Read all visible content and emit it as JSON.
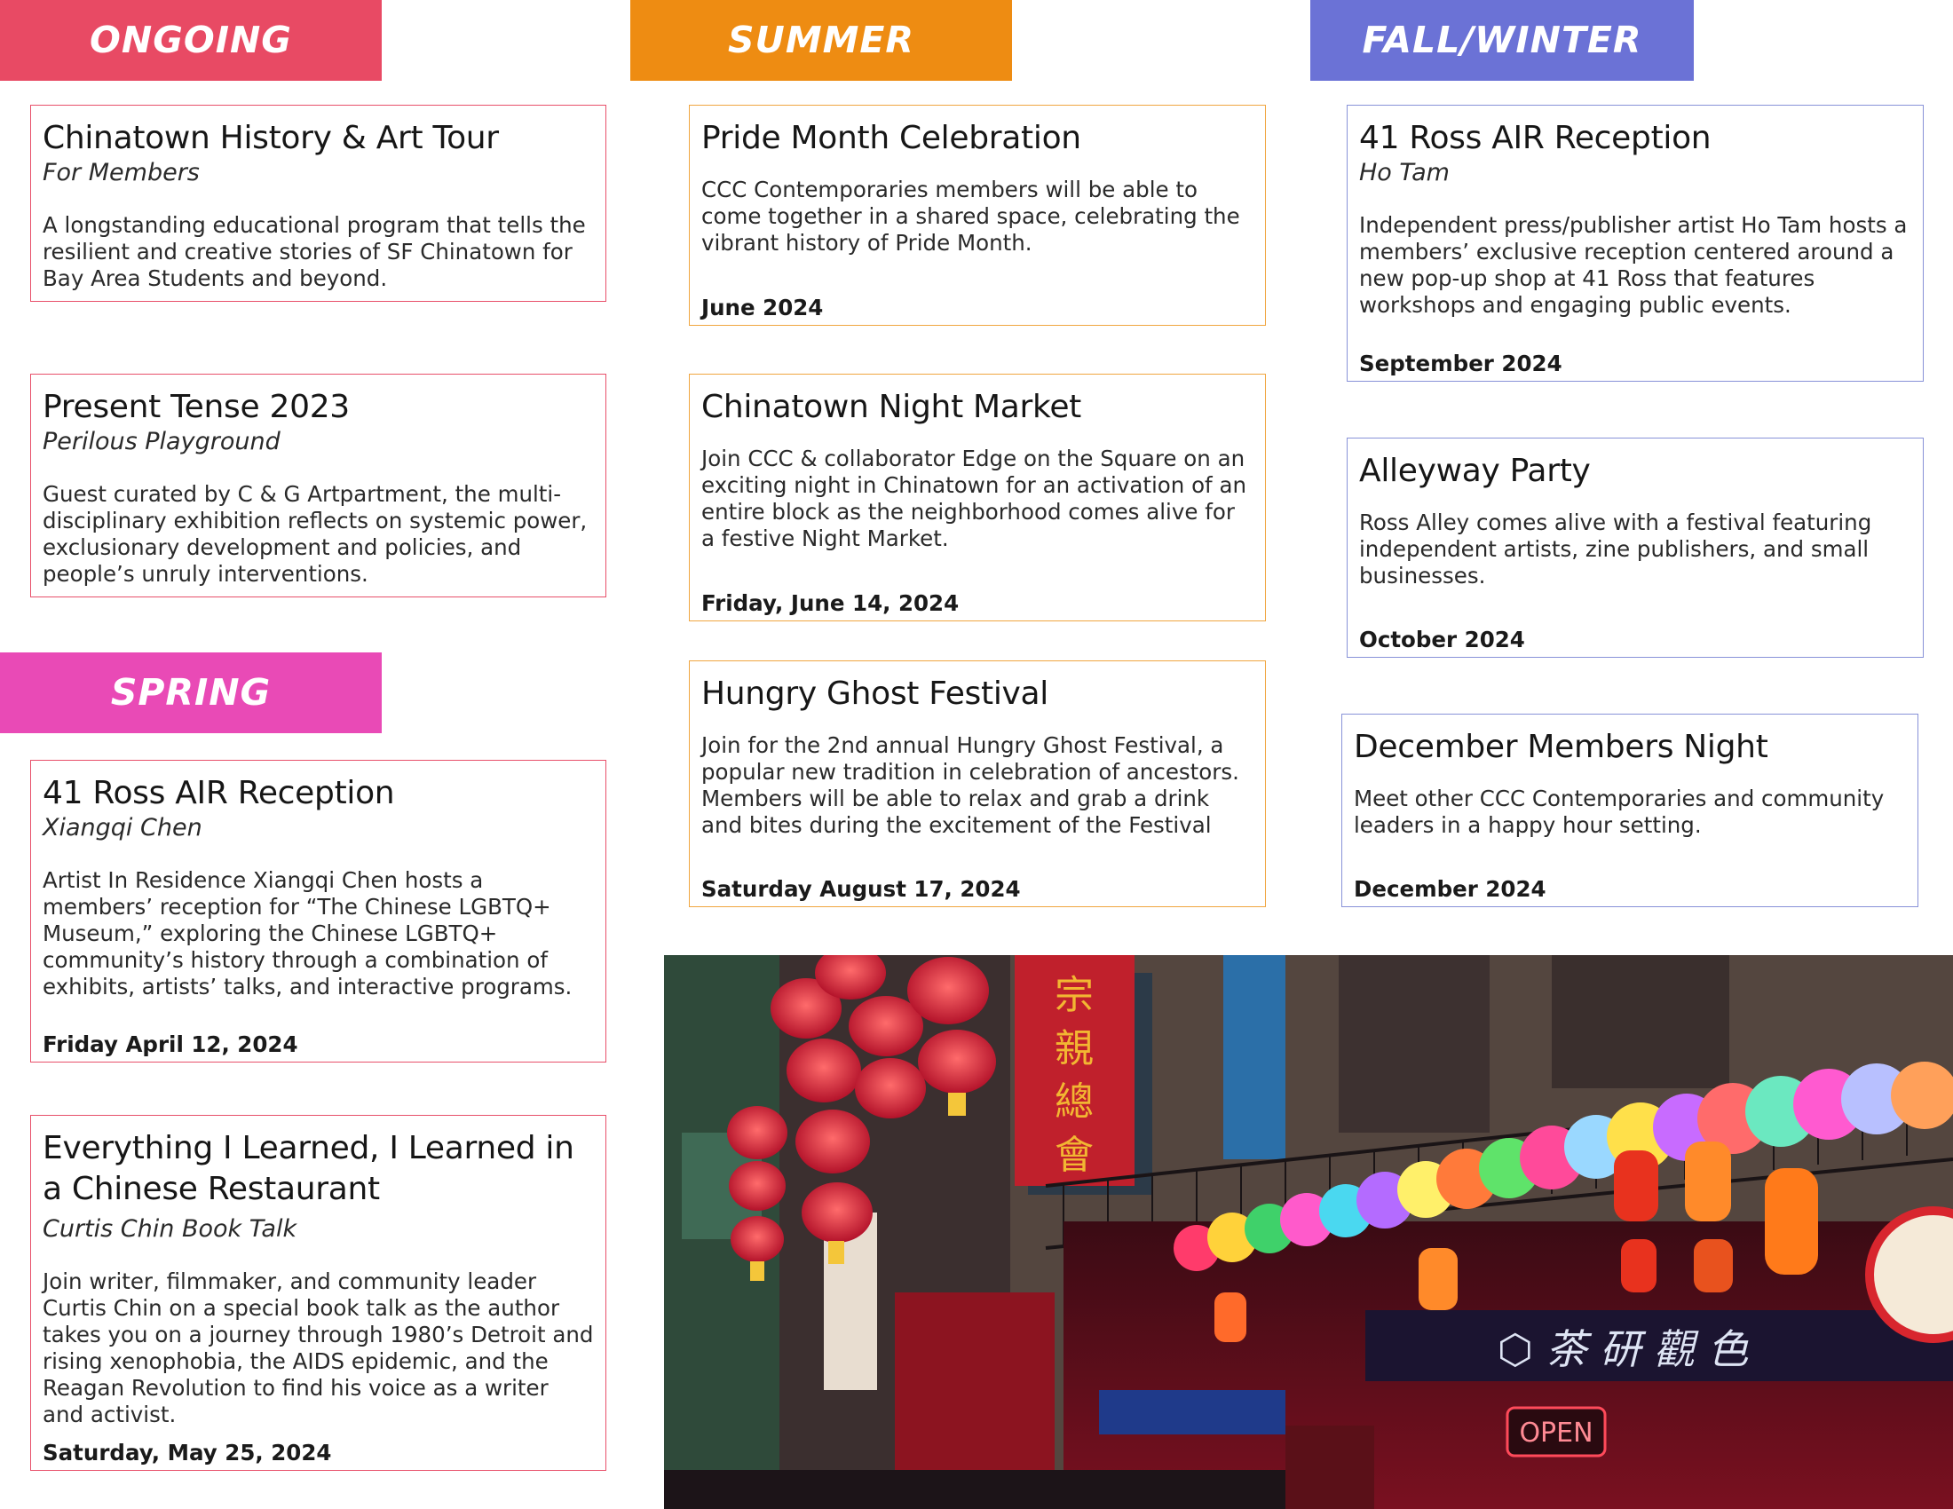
{
  "sections": {
    "ongoing": {
      "label": "ONGOING",
      "color": "#e84a64"
    },
    "summer": {
      "label": "SUMMER",
      "color": "#ee8c12"
    },
    "fall": {
      "label": "FALL/WINTER",
      "color": "#6b72d6"
    },
    "spring": {
      "label": "SPRING",
      "color": "#e94ab6"
    }
  },
  "cards": {
    "history_tour": {
      "title": "Chinatown History & Art Tour",
      "subtitle": "For Members",
      "desc": "A longstanding educational program that tells the resilient and creative stories of SF Chinatown for Bay Area Students and beyond."
    },
    "present_tense": {
      "title": "Present Tense 2023",
      "subtitle": "Perilous Playground",
      "desc": "Guest curated by C & G Artpartment, the multi-disciplinary exhibition reflects on systemic power, exclusionary development and policies, and people’s unruly interventions."
    },
    "spring_air": {
      "title": "41 Ross AIR Reception",
      "subtitle": "Xiangqi Chen",
      "desc": "Artist In Residence Xiangqi Chen hosts a members’ reception for “The Chinese LGBTQ+ Museum,” exploring the Chinese LGBTQ+ community’s history through a combination of exhibits, artists’ talks, and interactive programs.",
      "date": "Friday April 12, 2024"
    },
    "book_talk": {
      "title": "Everything I Learned, I Learned in a Chinese Restaurant",
      "subtitle": "Curtis Chin Book Talk",
      "desc": "Join writer, filmmaker, and community leader Curtis Chin on a special book talk as the author takes you on a journey through 1980’s Detroit and rising xenophobia, the AIDS epidemic, and the Reagan Revolution to find his voice as a writer and activist.",
      "date": "Saturday, May 25, 2024"
    },
    "pride": {
      "title": "Pride Month Celebration",
      "desc": "CCC Contemporaries members will be able to come together in a shared space, celebrating the vibrant history of Pride Month.",
      "date": "June 2024"
    },
    "night_market": {
      "title": "Chinatown Night Market",
      "desc": "Join CCC & collaborator Edge on the Square on an exciting night in Chinatown for an activation of an entire block as the neighborhood comes alive for a festive Night Market.",
      "date": "Friday, June 14, 2024"
    },
    "hungry_ghost": {
      "title": "Hungry Ghost Festival",
      "desc": "Join for the 2nd annual Hungry Ghost Festival, a popular new tradition in celebration of ancestors. Members will be able to relax and grab a drink and bites during the excitement of the Festival",
      "date": "Saturday August 17, 2024"
    },
    "fall_air": {
      "title": "41 Ross AIR Reception",
      "subtitle": "Ho Tam",
      "desc": "Independent press/publisher artist Ho Tam hosts a members’ exclusive reception centered around a new pop-up shop at 41 Ross that features workshops and engaging public events.",
      "date": "September 2024"
    },
    "alleyway": {
      "title": "Alleyway Party",
      "desc": "Ross Alley comes alive with a festival featuring independent artists, zine publishers, and small businesses.",
      "date": "October 2024"
    },
    "december": {
      "title": "December Members Night",
      "desc": "Meet other CCC Contemporaries and community leaders in a happy hour setting.",
      "date": "December 2024"
    },
    "photo": {
      "sign_open": "OPEN"
    }
  }
}
